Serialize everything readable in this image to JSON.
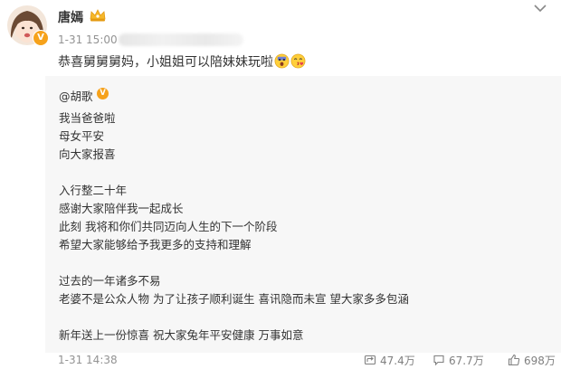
{
  "post": {
    "author": "唐嫣",
    "time": "1-31 15:00",
    "text": "恭喜舅舅舅妈，小姐姐可以陪妹妹玩啦"
  },
  "repost": {
    "mention": "@胡歌",
    "lines": [
      "我当爸爸啦",
      "母女平安",
      "向大家报喜",
      "",
      "入行整二十年",
      "感谢大家陪伴我一起成长",
      "此刻 我将和你们共同迈向人生的下一个阶段",
      "希望大家能够给予我更多的支持和理解",
      "",
      "过去的一年诸多不易",
      "老婆不是公众人物 为了让孩子顺利诞生 喜讯隐而未宣 望大家多多包涵",
      "",
      "新年送上一份惊喜 祝大家兔年平安健康 万事如意"
    ],
    "time": "1-31 14:38",
    "stats": {
      "forward": "47.4万",
      "comment": "67.7万",
      "like": "698万"
    }
  },
  "icons": {
    "verified_badge": "verified-v-badge",
    "member_crown": "member-crown-icon",
    "more": "chevron-down-icon",
    "forward": "forward-icon",
    "comment": "comment-icon",
    "like": "thumb-up-icon"
  },
  "colors": {
    "badge": "#f6a21b",
    "meta_gray": "#939393",
    "repost_bg": "#f7f7f7"
  }
}
